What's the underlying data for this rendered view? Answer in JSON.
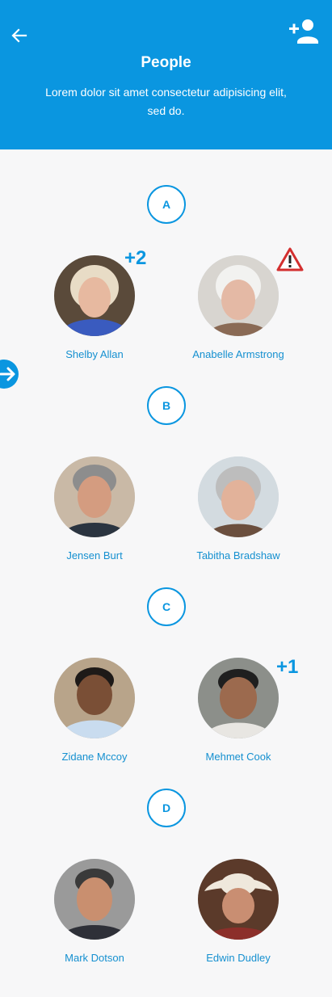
{
  "header": {
    "title": "People",
    "subtitle": "Lorem dolor sit amet consectetur adipisicing elit, sed do.",
    "background": "#0a96e0",
    "back_icon": "arrow-left-icon",
    "add_icon": "person-add-icon"
  },
  "side_nav": {
    "icon": "arrow-right-circle-icon"
  },
  "sections": [
    {
      "letter": "A",
      "people": [
        {
          "name": "Shelby Allan",
          "badge": "+2"
        },
        {
          "name": "Anabelle Armstrong",
          "alert_icon": "warning-triangle-icon"
        }
      ]
    },
    {
      "letter": "B",
      "people": [
        {
          "name": "Jensen Burt"
        },
        {
          "name": "Tabitha Bradshaw"
        }
      ]
    },
    {
      "letter": "C",
      "people": [
        {
          "name": "Zidane Mccoy"
        },
        {
          "name": "Mehmet Cook",
          "badge": "+1"
        }
      ]
    },
    {
      "letter": "D",
      "people": [
        {
          "name": "Mark Dotson"
        },
        {
          "name": "Edwin Dudley"
        }
      ]
    }
  ],
  "colors": {
    "accent": "#0a96e0",
    "warning": "#d32f2f",
    "background": "#f7f7f8"
  }
}
